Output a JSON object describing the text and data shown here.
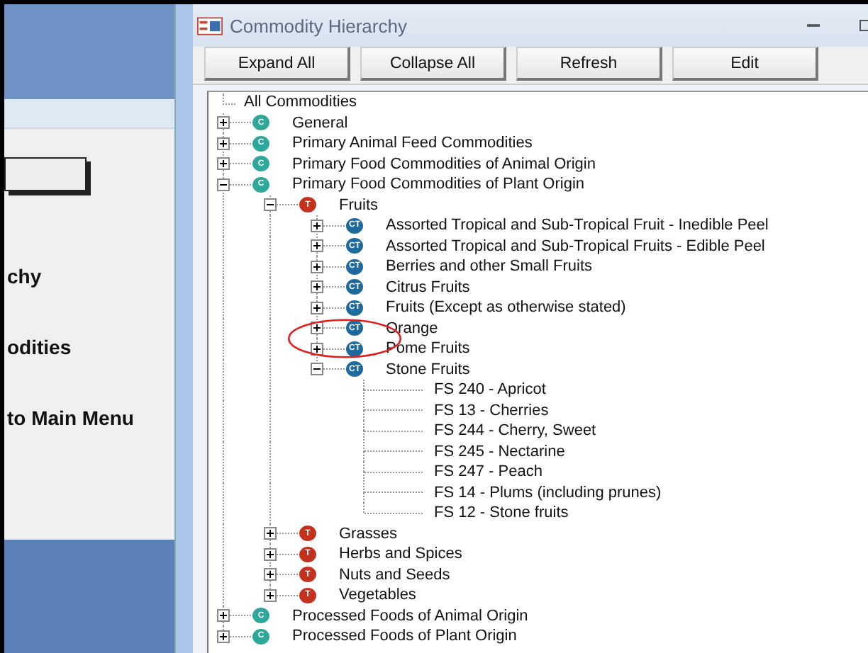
{
  "left_panel": {
    "labels": [
      "chy",
      "odities",
      "to Main Menu"
    ]
  },
  "window": {
    "title": "Commodity Hierarchy"
  },
  "toolbar": {
    "buttons": [
      "Expand All",
      "Collapse All",
      "Refresh",
      "Edit"
    ]
  },
  "tree": {
    "label": "All Commodities",
    "children": [
      {
        "label": "General",
        "kind": "C",
        "badge": "C",
        "expanded": false
      },
      {
        "label": "Primary Animal Feed Commodities",
        "kind": "C",
        "badge": "C",
        "expanded": false
      },
      {
        "label": "Primary Food Commodities of Animal Origin",
        "kind": "C",
        "badge": "C",
        "expanded": false
      },
      {
        "label": "Primary Food Commodities of Plant Origin",
        "kind": "C",
        "badge": "C",
        "expanded": true,
        "children": [
          {
            "label": "Fruits",
            "kind": "T",
            "badge": "T",
            "expanded": true,
            "children": [
              {
                "label": "Assorted Tropical and Sub-Tropical Fruit - Inedible Peel",
                "kind": "CT",
                "badge": "CT",
                "expanded": false
              },
              {
                "label": "Assorted Tropical and Sub-Tropical Fruits - Edible Peel",
                "kind": "CT",
                "badge": "CT",
                "expanded": false
              },
              {
                "label": "Berries and other Small Fruits",
                "kind": "CT",
                "badge": "CT",
                "expanded": false
              },
              {
                "label": "Citrus Fruits",
                "kind": "CT",
                "badge": "CT",
                "expanded": false
              },
              {
                "label": "Fruits (Except as otherwise stated)",
                "kind": "CT",
                "badge": "CT",
                "expanded": false
              },
              {
                "label": "Orange",
                "kind": "CT",
                "badge": "CT",
                "expanded": false
              },
              {
                "label": "Pome Fruits",
                "kind": "CT",
                "badge": "CT",
                "expanded": false
              },
              {
                "label": "Stone Fruits",
                "kind": "CT",
                "badge": "CT",
                "expanded": true,
                "children": [
                  {
                    "label": "FS 240 - Apricot",
                    "kind": "leaf"
                  },
                  {
                    "label": "FS 13 - Cherries",
                    "kind": "leaf"
                  },
                  {
                    "label": "FS 244 - Cherry, Sweet",
                    "kind": "leaf"
                  },
                  {
                    "label": "FS 245 - Nectarine",
                    "kind": "leaf"
                  },
                  {
                    "label": "FS 247 - Peach",
                    "kind": "leaf"
                  },
                  {
                    "label": "FS 14 - Plums (including prunes)",
                    "kind": "leaf"
                  },
                  {
                    "label": "FS 12 - Stone fruits",
                    "kind": "leaf"
                  }
                ]
              }
            ]
          },
          {
            "label": "Grasses",
            "kind": "T",
            "badge": "T",
            "expanded": false
          },
          {
            "label": "Herbs and Spices",
            "kind": "T",
            "badge": "T",
            "expanded": false
          },
          {
            "label": "Nuts and Seeds",
            "kind": "T",
            "badge": "T",
            "expanded": false
          },
          {
            "label": "Vegetables",
            "kind": "T",
            "badge": "T",
            "expanded": false
          }
        ]
      },
      {
        "label": "Processed Foods of Animal Origin",
        "kind": "C",
        "badge": "C",
        "expanded": false
      },
      {
        "label": "Processed Foods of Plant Origin",
        "kind": "C",
        "badge": "C",
        "expanded": false
      }
    ]
  }
}
